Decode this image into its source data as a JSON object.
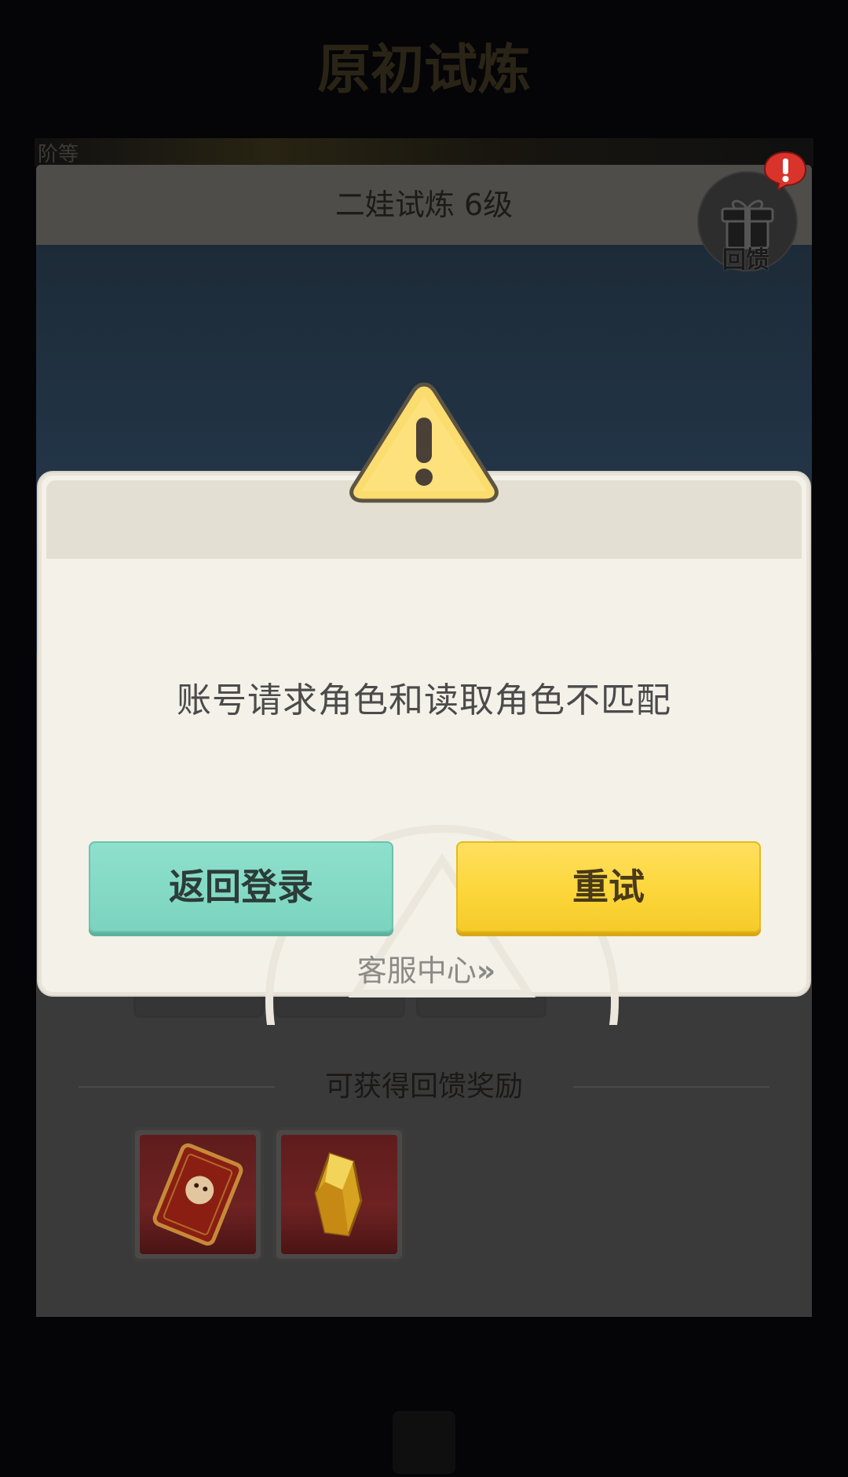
{
  "page": {
    "title": "原初试炼",
    "strip_text": "阶等"
  },
  "panel": {
    "title": "二娃试炼 6级",
    "reward_heading": "可获得回馈奖励",
    "gift_label": "回馈"
  },
  "dialog": {
    "message": "账号请求角色和读取角色不匹配",
    "back_label": "返回登录",
    "retry_label": "重试",
    "support_label": "客服中心",
    "support_chevron": "»"
  },
  "colors": {
    "dialog_bg": "#f4f1e9",
    "back_button": "#7bd4bf",
    "retry_button": "#fcd63a",
    "warning_icon": "#fbdc6e",
    "alert_badge": "#d9342b"
  }
}
